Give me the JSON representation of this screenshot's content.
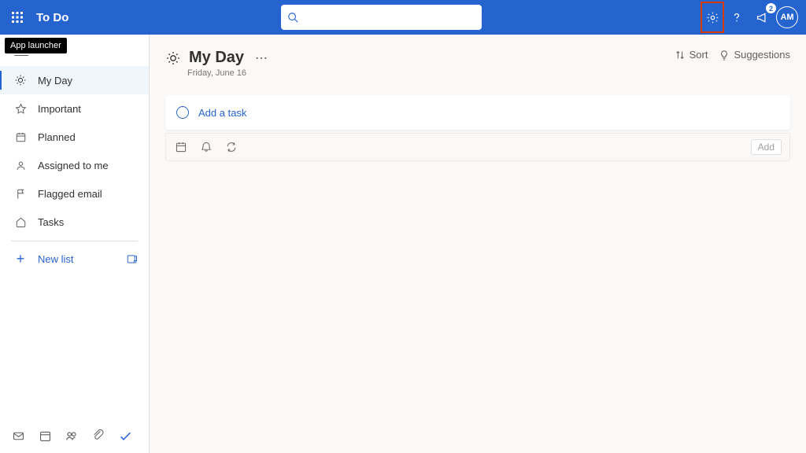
{
  "header": {
    "app_title": "To Do",
    "tooltip": "App launcher",
    "search_value": "",
    "avatar_initials": "AM",
    "megaphone_badge": "2"
  },
  "sidebar": {
    "items": [
      {
        "label": "My Day"
      },
      {
        "label": "Important"
      },
      {
        "label": "Planned"
      },
      {
        "label": "Assigned to me"
      },
      {
        "label": "Flagged email"
      },
      {
        "label": "Tasks"
      }
    ],
    "new_list_label": "New list"
  },
  "main": {
    "title": "My Day",
    "date": "Friday, June 16",
    "sort_label": "Sort",
    "suggestions_label": "Suggestions",
    "add_task_placeholder": "Add a task",
    "add_button": "Add"
  }
}
